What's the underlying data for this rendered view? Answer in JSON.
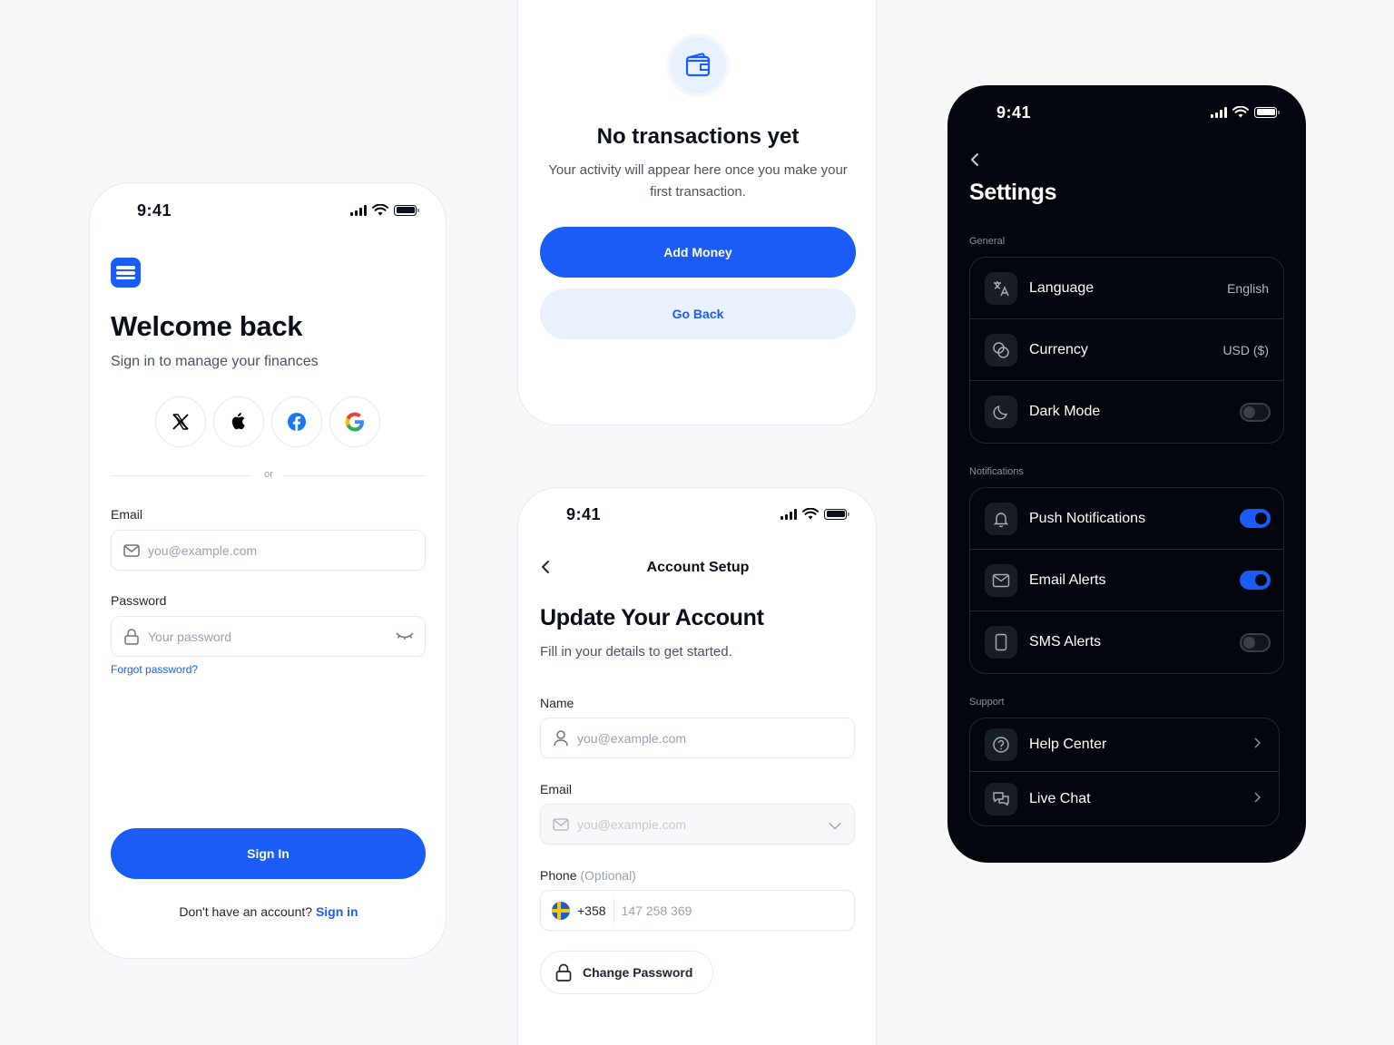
{
  "status_time": "9:41",
  "login": {
    "title": "Welcome back",
    "subtitle": "Sign in to manage your finances",
    "divider_text": "or",
    "email_label": "Email",
    "email_placeholder": "you@example.com",
    "password_label": "Password",
    "password_placeholder": "Your password",
    "forgot_link": "Forgot password?",
    "signin_button": "Sign In",
    "footer_text": "Don't have an account?",
    "footer_link": "Sign in",
    "social": [
      "x-logo-icon",
      "apple-logo-icon",
      "facebook-logo-icon",
      "google-logo-icon"
    ]
  },
  "empty_state": {
    "icon": "wallet-icon",
    "title": "No transactions yet",
    "description": "Your activity will appear here once you make your first transaction.",
    "primary_button": "Add Money",
    "secondary_button": "Go Back"
  },
  "account_setup": {
    "nav_title": "Account Setup",
    "title": "Update Your Account",
    "subtitle": "Fill in your details to get started.",
    "name_label": "Name",
    "name_placeholder": "you@example.com",
    "email_label": "Email",
    "email_placeholder": "you@example.com",
    "phone_label": "Phone",
    "phone_optional": "(Optional)",
    "phone_code": "+358",
    "phone_placeholder": "147 258 369",
    "change_password": "Change Password"
  },
  "settings": {
    "title": "Settings",
    "sections": {
      "general": "General",
      "notifications": "Notifications",
      "support": "Support"
    },
    "language": {
      "label": "Language",
      "value": "English"
    },
    "currency": {
      "label": "Currency",
      "value": "USD ($)"
    },
    "dark_mode": {
      "label": "Dark Mode",
      "on": false
    },
    "push": {
      "label": "Push Notifications",
      "on": true
    },
    "email_alerts": {
      "label": "Email Alerts",
      "on": true
    },
    "sms_alerts": {
      "label": "SMS Alerts",
      "on": false
    },
    "help": {
      "label": "Help Center"
    },
    "chat": {
      "label": "Live Chat"
    }
  },
  "colors": {
    "accent": "#1a5cf5",
    "accent_soft": "#e8f1fd",
    "dark_bg": "#03060f"
  }
}
